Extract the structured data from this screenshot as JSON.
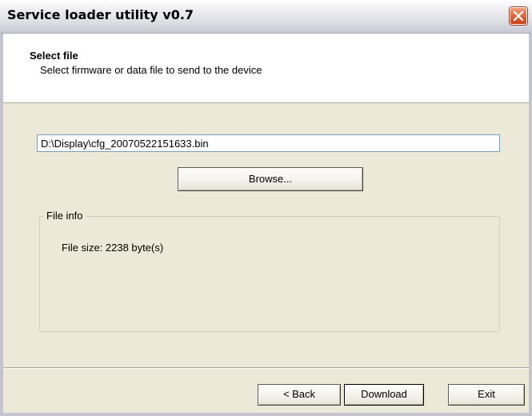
{
  "window": {
    "title": "Service loader utility v0.7"
  },
  "header": {
    "title": "Select file",
    "subtitle": "Select firmware or data file to send to the device"
  },
  "file": {
    "path": "D:\\Display\\cfg_20070522151633.bin",
    "browse_label": "Browse..."
  },
  "file_info": {
    "group_label": "File info",
    "size_text": "File size: 2238 byte(s)"
  },
  "nav": {
    "back_label": "< Back",
    "download_label": "Download",
    "exit_label": "Exit"
  },
  "colors": {
    "dialog_bg": "#ece9d8",
    "header_bg": "#ffffff",
    "close_button": "#e26a3c"
  },
  "icons": {
    "close": "close-icon"
  }
}
